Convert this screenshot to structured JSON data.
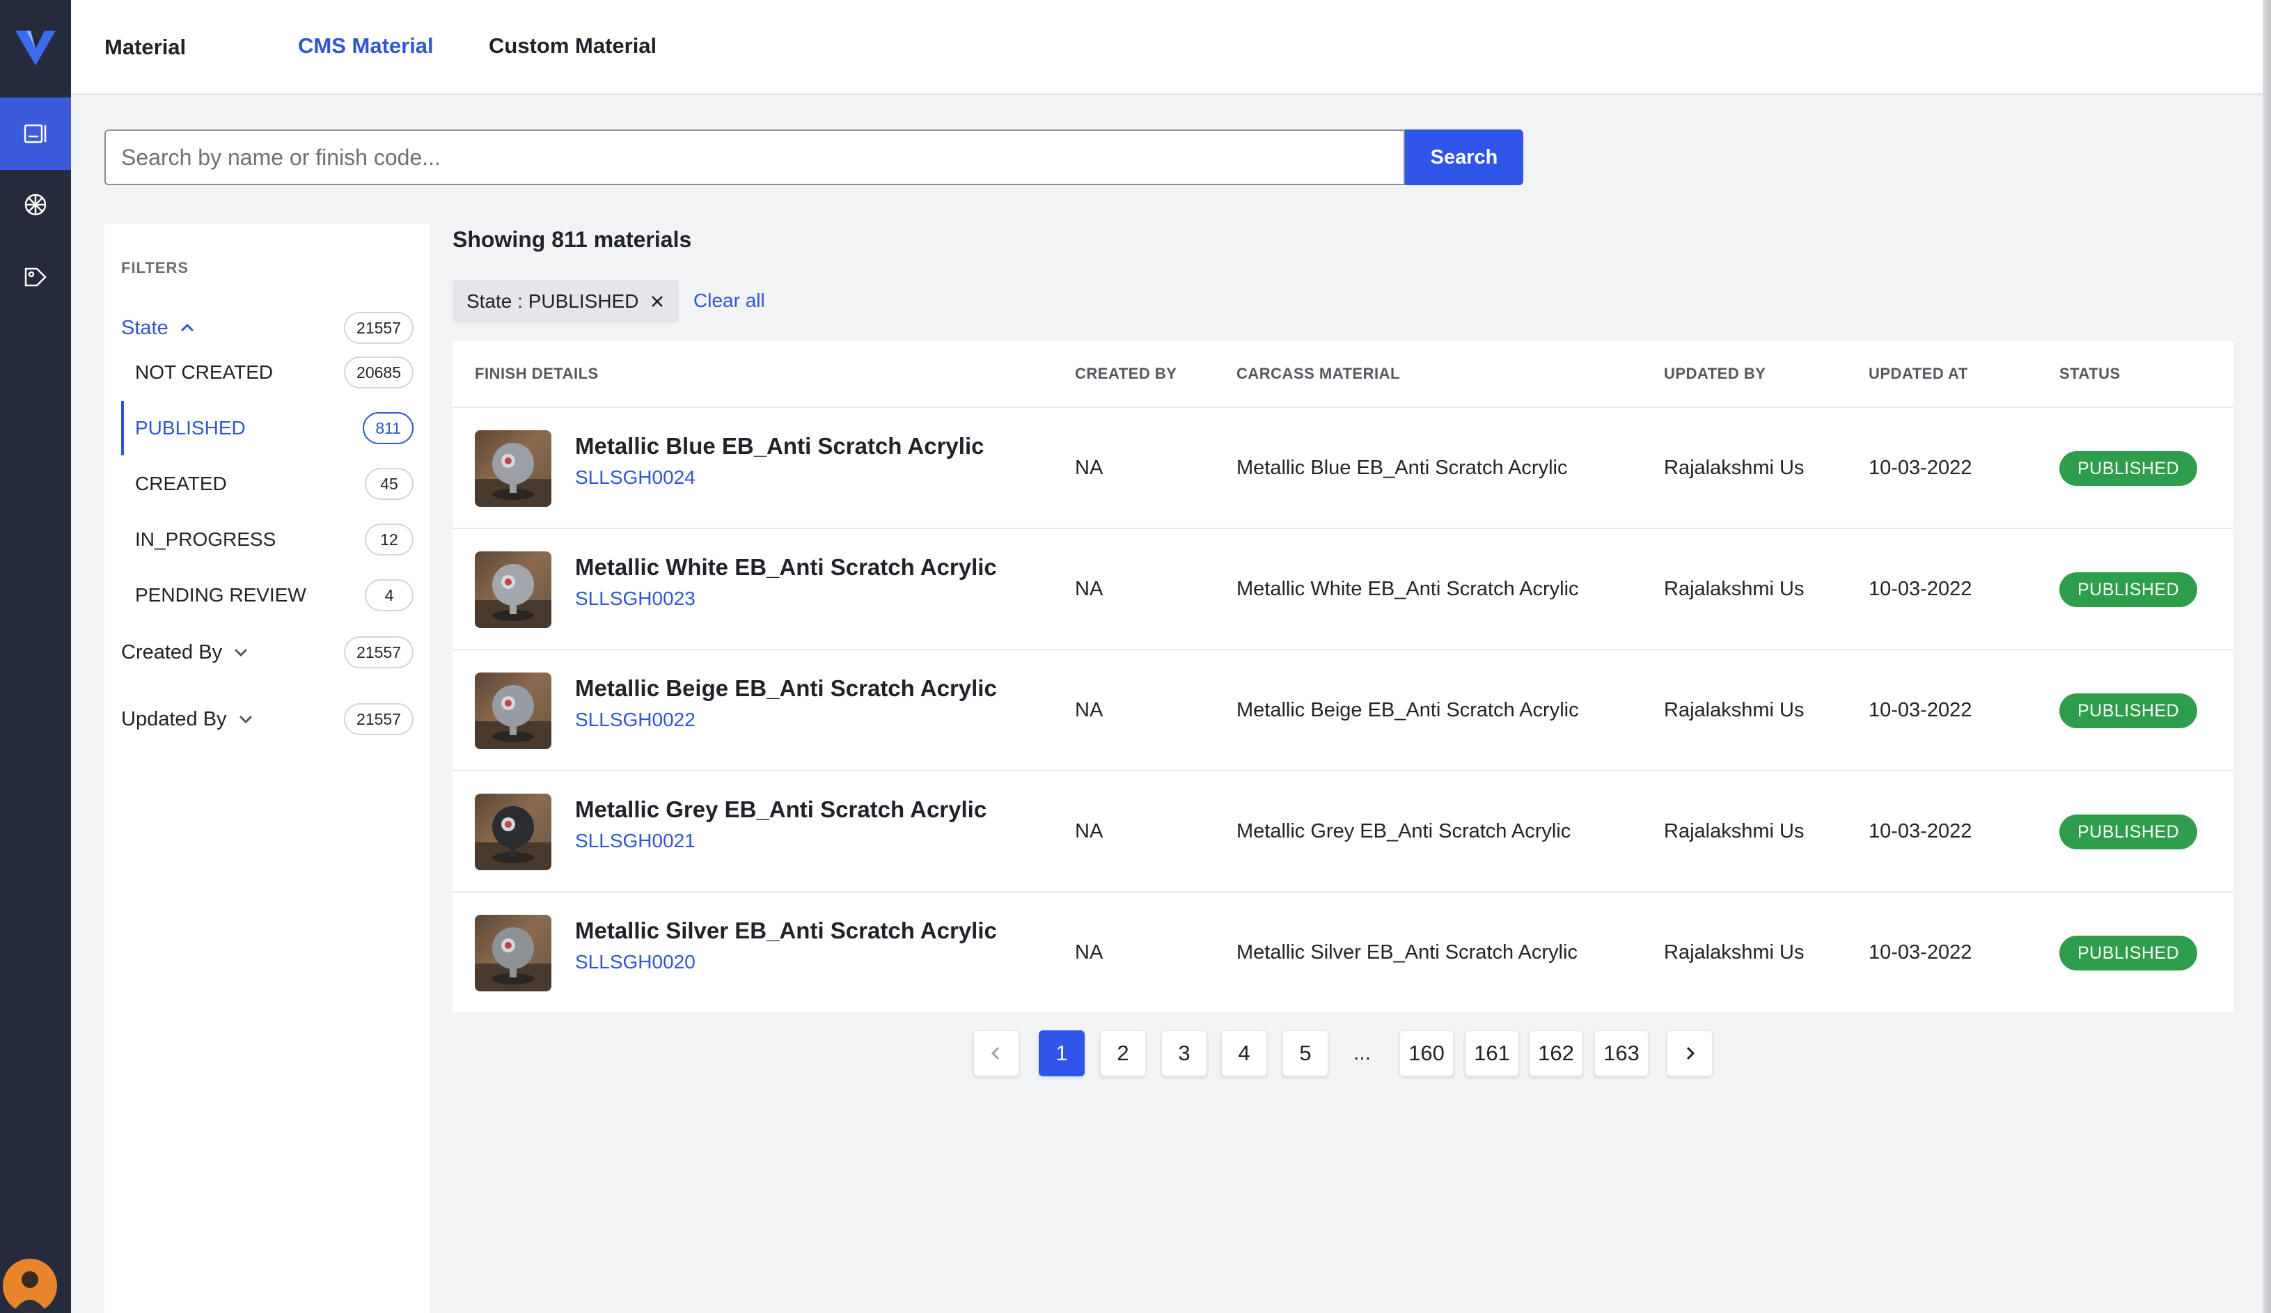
{
  "rail": {
    "items": [
      {
        "name": "materials-nav",
        "icon": "book-icon",
        "active": true
      },
      {
        "name": "textures-nav",
        "icon": "grid-ball-icon",
        "active": false
      },
      {
        "name": "tags-nav",
        "icon": "tag-icon",
        "active": false
      }
    ]
  },
  "header": {
    "title": "Material",
    "tabs": [
      {
        "label": "CMS Material",
        "active": true
      },
      {
        "label": "Custom Material",
        "active": false
      }
    ]
  },
  "search": {
    "placeholder": "Search by name or finish code...",
    "value": "",
    "button_label": "Search"
  },
  "filters": {
    "heading": "FILTERS",
    "state": {
      "label": "State",
      "count": "21557"
    },
    "options": [
      {
        "label": "NOT CREATED",
        "count": "20685",
        "active": false
      },
      {
        "label": "PUBLISHED",
        "count": "811",
        "active": true
      },
      {
        "label": "CREATED",
        "count": "45",
        "active": false
      },
      {
        "label": "IN_PROGRESS",
        "count": "12",
        "active": false
      },
      {
        "label": "PENDING REVIEW",
        "count": "4",
        "active": false
      }
    ],
    "created_by": {
      "label": "Created By",
      "count": "21557"
    },
    "updated_by": {
      "label": "Updated By",
      "count": "21557"
    }
  },
  "results": {
    "showing": "Showing 811 materials",
    "active_filter": "State : PUBLISHED",
    "clear_all": "Clear all"
  },
  "table": {
    "columns": [
      "FINISH DETAILS",
      "CREATED BY",
      "CARCASS MATERIAL",
      "UPDATED BY",
      "UPDATED AT",
      "STATUS"
    ],
    "rows": [
      {
        "name": "Metallic Blue EB_Anti Scratch Acrylic",
        "code": "SLLSGH0024",
        "created_by": "NA",
        "carcass": "Metallic Blue EB_Anti Scratch Acrylic",
        "updated_by": "Rajalakshmi Us",
        "updated_at": "10-03-2022",
        "status": "PUBLISHED",
        "ball_color": "#9aa0a6"
      },
      {
        "name": "Metallic White EB_Anti Scratch Acrylic",
        "code": "SLLSGH0023",
        "created_by": "NA",
        "carcass": "Metallic White EB_Anti Scratch Acrylic",
        "updated_by": "Rajalakshmi Us",
        "updated_at": "10-03-2022",
        "status": "PUBLISHED",
        "ball_color": "#a3a7ad"
      },
      {
        "name": "Metallic Beige EB_Anti Scratch Acrylic",
        "code": "SLLSGH0022",
        "created_by": "NA",
        "carcass": "Metallic Beige EB_Anti Scratch Acrylic",
        "updated_by": "Rajalakshmi Us",
        "updated_at": "10-03-2022",
        "status": "PUBLISHED",
        "ball_color": "#989ca2"
      },
      {
        "name": "Metallic Grey EB_Anti Scratch Acrylic",
        "code": "SLLSGH0021",
        "created_by": "NA",
        "carcass": "Metallic Grey EB_Anti Scratch Acrylic",
        "updated_by": "Rajalakshmi Us",
        "updated_at": "10-03-2022",
        "status": "PUBLISHED",
        "ball_color": "#2b2d30"
      },
      {
        "name": "Metallic Silver EB_Anti Scratch Acrylic",
        "code": "SLLSGH0020",
        "created_by": "NA",
        "carcass": "Metallic Silver EB_Anti Scratch Acrylic",
        "updated_by": "Rajalakshmi Us",
        "updated_at": "10-03-2022",
        "status": "PUBLISHED",
        "ball_color": "#8e9297"
      }
    ]
  },
  "pagination": {
    "pages": [
      "1",
      "2",
      "3",
      "4",
      "5",
      "160",
      "161",
      "162",
      "163"
    ],
    "current": "1",
    "ellipsis": "..."
  },
  "colors": {
    "accent": "#2f55ea",
    "rail": "#262a3d",
    "status_published": "#2e9e4c"
  }
}
